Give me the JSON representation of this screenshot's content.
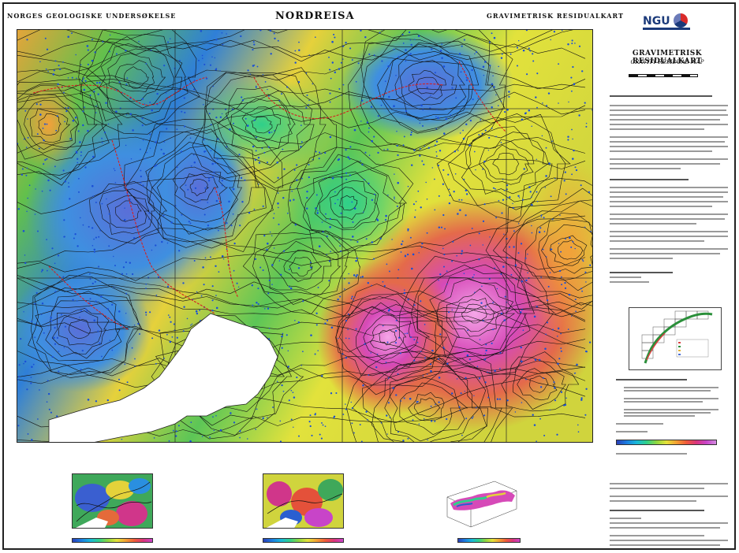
{
  "header": {
    "left_title": "NORGES GEOLOGISKE UNDERSØKELSE",
    "center_title": "NORDREISA",
    "right_title": "GRAVIMETRISK RESIDUALKART"
  },
  "sidebar": {
    "logo": "NGU",
    "title": "GRAVIMETRISK RESIDUALKART",
    "subtitle": "GRAVITY RESIDUAL MAP"
  },
  "colors": {
    "ramp": [
      "#2a3fb8",
      "#1c7de0",
      "#19b8d8",
      "#2fd08a",
      "#8fd640",
      "#e4e23a",
      "#f3a133",
      "#ef5b3a",
      "#d9357c",
      "#c844c8",
      "#d38ae0"
    ],
    "contour": "#111111",
    "stations": "#1a4fd6",
    "faults": "#d62020",
    "mask": "#ffffff"
  }
}
